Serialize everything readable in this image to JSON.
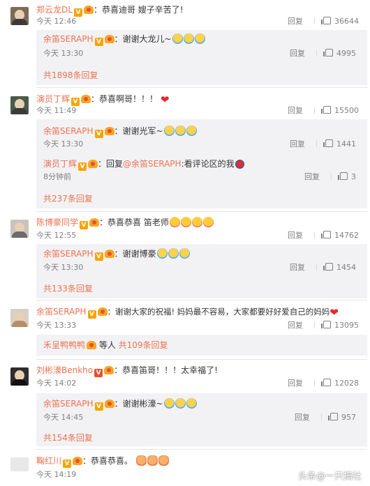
{
  "comments": [
    {
      "name": "郑云龙DL",
      "badge": "V",
      "text": "：恭喜迪哥 嫂子辛苦了!",
      "time": "今天 12:46",
      "reply": "回复",
      "likes": "36644",
      "replies": [
        {
          "name": "余笛SERAPH",
          "text": "：谢谢大龙儿~",
          "time": "今天 13:30",
          "reply": "回复",
          "likes": "4995"
        }
      ],
      "more": "共1898条回复"
    },
    {
      "name": "演员丁辉",
      "badge": "V",
      "text": "：恭喜啊哥！！！",
      "time": "今天 11:49",
      "reply": "回复",
      "likes": "15500",
      "replies": [
        {
          "name": "余笛SERAPH",
          "text": "：谢谢光军~",
          "time": "今天 13:30",
          "reply": "回复",
          "likes": "1441"
        },
        {
          "name": "演员丁辉",
          "text": "：回复",
          "mention": "@余笛SERAPH",
          "text2": ":看评论区的我",
          "time": "8分钟前",
          "reply": "回复",
          "likes": "3"
        }
      ],
      "more": "共237条回复"
    },
    {
      "name": "陈博豪同学",
      "badge": "V",
      "text": "：恭喜恭喜 笛老师",
      "time": "今天 12:55",
      "reply": "回复",
      "likes": "14762",
      "replies": [
        {
          "name": "余笛SERAPH",
          "text": "：谢谢博豪",
          "time": "今天 13:30",
          "reply": "回复",
          "likes": "1454"
        }
      ],
      "more": "共133条回复"
    },
    {
      "name": "余笛SERAPH",
      "badge": "V",
      "text": "：谢谢大家的祝福! 妈妈最不容易，大家都要好好爱自己的妈妈",
      "time": "今天 13:33",
      "reply": "回复",
      "likes": "13095",
      "replies": [],
      "more_user": "禾呈鸭鸭鸭",
      "more_mid": " 等人 ",
      "more": "共109条回复"
    },
    {
      "name": "刘彬濠Benkho",
      "badge": "V",
      "text": "：恭喜笛哥！！！太幸福了!",
      "time": "今天 14:02",
      "reply": "回复",
      "likes": "12028",
      "replies": [
        {
          "name": "余笛SERAPH",
          "text": "：谢谢彬濠~",
          "time": "今天 14:45",
          "reply": "回复",
          "likes": "957"
        }
      ],
      "more": "共154条回复"
    },
    {
      "name": "鞠红川",
      "badge": "V",
      "text": "：恭喜恭喜。",
      "time": "今天 14:19",
      "reply": "",
      "likes": ""
    }
  ],
  "watermark": "头条@一只搞社",
  "colors": {
    "accent": "#eb7350",
    "subbg": "#f2f2f5",
    "meta": "#808080"
  }
}
